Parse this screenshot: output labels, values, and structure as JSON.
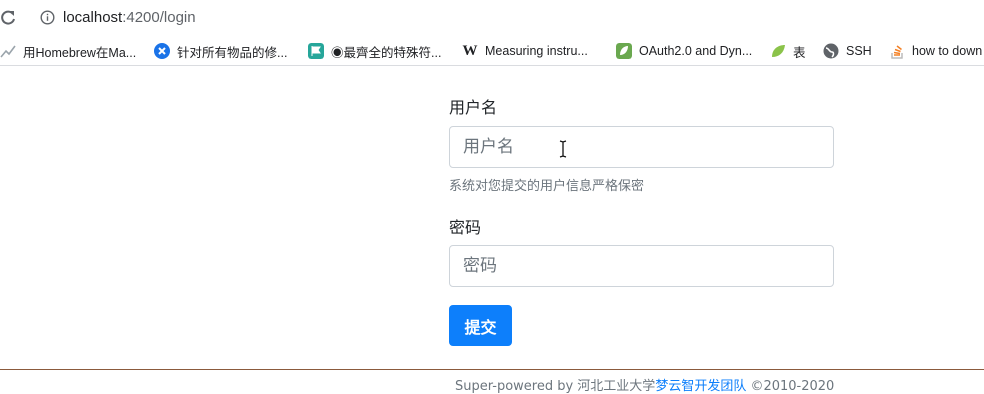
{
  "browser": {
    "url_host": "localhost",
    "url_path": ":4200/login",
    "bookmarks": [
      {
        "label": "用Homebrew在Ma...",
        "icon": "chart-line-icon",
        "color": "#b0bec5"
      },
      {
        "label": "针对所有物品的修...",
        "icon": "close-circle-icon",
        "color": "#1a73e8"
      },
      {
        "label": "◉最齊全的特殊符...",
        "icon": "flag-icon",
        "color": "#26a69a"
      },
      {
        "label": "Measuring instru...",
        "icon": "wikipedia-icon",
        "color": "#202124"
      },
      {
        "label": "OAuth2.0 and Dyn...",
        "icon": "leaf-icon",
        "color": "#6aa84f"
      },
      {
        "label": "表",
        "icon": "leaf-icon",
        "color": "#8bc34a"
      },
      {
        "label": "SSH",
        "icon": "globe-icon",
        "color": "#5f6368"
      },
      {
        "label": "how to down",
        "icon": "stackoverflow-icon",
        "color": "#f48024"
      }
    ]
  },
  "form": {
    "username_label": "用户名",
    "username_placeholder": "用户名",
    "username_help": "系统对您提交的用户信息严格保密",
    "password_label": "密码",
    "password_placeholder": "密码",
    "submit_label": "提交"
  },
  "footer": {
    "prefix": "Super-powered by 河北工业大学",
    "team_link": "梦云智开发团队",
    "suffix": " ©2010-2020"
  },
  "colors": {
    "primary": "#0d7ffb",
    "muted": "#6c757d",
    "border": "#ced4da"
  }
}
